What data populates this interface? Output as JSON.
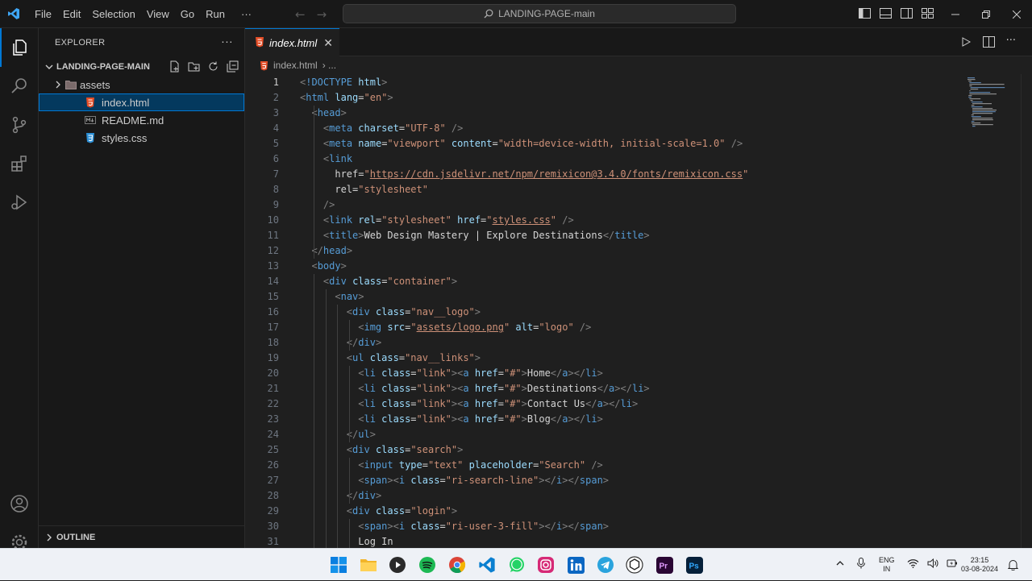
{
  "titlebar": {
    "menu": [
      "File",
      "Edit",
      "Selection",
      "View",
      "Go",
      "Run",
      "···"
    ],
    "command_center": "LANDING-PAGE-main",
    "accent": "#0078d4"
  },
  "explorer": {
    "title": "EXPLORER",
    "more": "···",
    "folder": "LANDING-PAGE-MAIN",
    "items": [
      {
        "label": "assets",
        "type": "folder"
      },
      {
        "label": "index.html",
        "type": "html",
        "selected": true
      },
      {
        "label": "README.md",
        "type": "md"
      },
      {
        "label": "styles.css",
        "type": "css"
      }
    ],
    "outline": "OUTLINE"
  },
  "editor": {
    "tab": "index.html",
    "tab_close": "✕",
    "breadcrumb": "index.html",
    "breadcrumb_sep": "› ...",
    "lines": [
      {
        "n": "1",
        "t": "<!DOCTYPE html>"
      },
      {
        "n": "2",
        "t": "<html lang=\"en\">"
      },
      {
        "n": "3",
        "t": "  <head>"
      },
      {
        "n": "4",
        "t": "    <meta charset=\"UTF-8\" />"
      },
      {
        "n": "5",
        "t": "    <meta name=\"viewport\" content=\"width=device-width, initial-scale=1.0\" />"
      },
      {
        "n": "6",
        "t": "    <link"
      },
      {
        "n": "7",
        "t": "      href=\"https://cdn.jsdelivr.net/npm/remixicon@3.4.0/fonts/remixicon.css\""
      },
      {
        "n": "8",
        "t": "      rel=\"stylesheet\""
      },
      {
        "n": "9",
        "t": "    />"
      },
      {
        "n": "10",
        "t": "    <link rel=\"stylesheet\" href=\"styles.css\" />"
      },
      {
        "n": "11",
        "t": "    <title>Web Design Mastery | Explore Destinations</title>"
      },
      {
        "n": "12",
        "t": "  </head>"
      },
      {
        "n": "13",
        "t": "  <body>"
      },
      {
        "n": "14",
        "t": "    <div class=\"container\">"
      },
      {
        "n": "15",
        "t": "      <nav>"
      },
      {
        "n": "16",
        "t": "        <div class=\"nav__logo\">"
      },
      {
        "n": "17",
        "t": "          <img src=\"assets/logo.png\" alt=\"logo\" />"
      },
      {
        "n": "18",
        "t": "        </div>"
      },
      {
        "n": "19",
        "t": "        <ul class=\"nav__links\">"
      },
      {
        "n": "20",
        "t": "          <li class=\"link\"><a href=\"#\">Home</a></li>"
      },
      {
        "n": "21",
        "t": "          <li class=\"link\"><a href=\"#\">Destinations</a></li>"
      },
      {
        "n": "22",
        "t": "          <li class=\"link\"><a href=\"#\">Contact Us</a></li>"
      },
      {
        "n": "23",
        "t": "          <li class=\"link\"><a href=\"#\">Blog</a></li>"
      },
      {
        "n": "24",
        "t": "        </ul>"
      },
      {
        "n": "25",
        "t": "        <div class=\"search\">"
      },
      {
        "n": "26",
        "t": "          <input type=\"text\" placeholder=\"Search\" />"
      },
      {
        "n": "27",
        "t": "          <span><i class=\"ri-search-line\"></i></span>"
      },
      {
        "n": "28",
        "t": "        </div>"
      },
      {
        "n": "29",
        "t": "        <div class=\"login\">"
      },
      {
        "n": "30",
        "t": "          <span><i class=\"ri-user-3-fill\"></i></span>"
      },
      {
        "n": "31",
        "t": "          Log In"
      }
    ]
  },
  "taskbar": {
    "apps": [
      "windows-start",
      "file-explorer",
      "media-player",
      "spotify",
      "chrome",
      "vscode",
      "whatsapp",
      "instagram",
      "linkedin",
      "telegram",
      "chatgpt",
      "premiere-pro",
      "photoshop"
    ],
    "lang_top": "ENG",
    "lang_bottom": "IN",
    "time": "23:15",
    "date": "03-08-2024"
  }
}
